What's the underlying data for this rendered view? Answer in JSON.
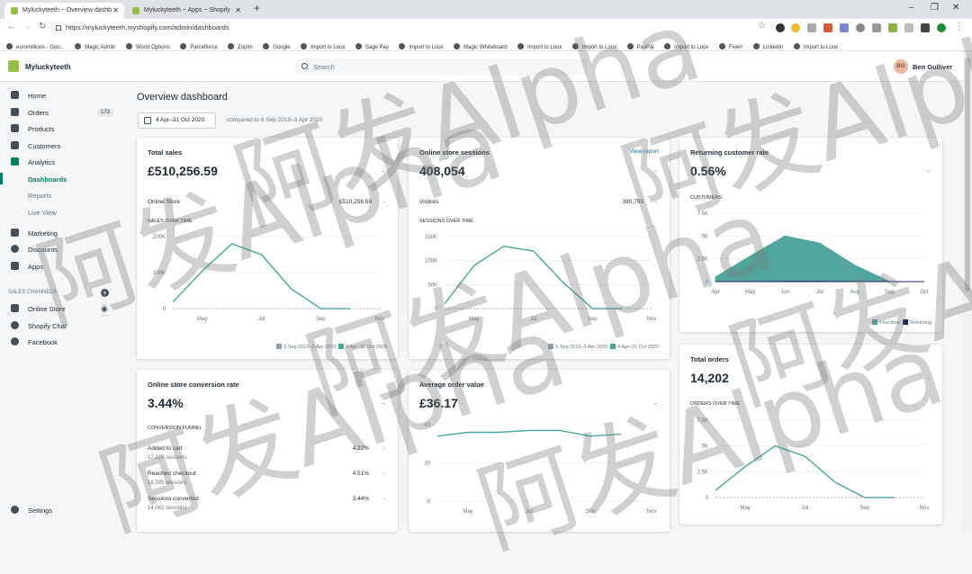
{
  "browser": {
    "tabs": [
      {
        "title": "Myluckyteeth ~ Overview dashb"
      },
      {
        "title": "Myluckyteeth ~ Apps ~ Shopify"
      }
    ],
    "url": "https://myluckyteeth.myshopify.com/admin/dashboards",
    "bookmarks": [
      "euromillions - Goo...",
      "Magic Admin",
      "World Options",
      "Parcelforce",
      "Zopim",
      "Google",
      "Import to Loox",
      "Sage Pay",
      "Import to Loox",
      "Magic Whiteboard",
      "Import to Loox",
      "Import to Loox",
      "PayPal",
      "Import to Loox",
      "Fiverr",
      "LinkedIn",
      "Import to Loox"
    ]
  },
  "topnav": {
    "store": "Myluckyteeth",
    "search_placeholder": "Search",
    "avatar": "BG",
    "user": "Ben Gulliver"
  },
  "sidebar": {
    "items": [
      {
        "label": "Home",
        "icon": "home-icon"
      },
      {
        "label": "Orders",
        "icon": "orders-icon",
        "badge": "173"
      },
      {
        "label": "Products",
        "icon": "tag-icon"
      },
      {
        "label": "Customers",
        "icon": "person-icon"
      },
      {
        "label": "Analytics",
        "icon": "bar-chart-icon"
      },
      {
        "label": "Dashboards"
      },
      {
        "label": "Reports"
      },
      {
        "label": "Live View"
      },
      {
        "label": "Marketing",
        "icon": "megaphone-icon"
      },
      {
        "label": "Discounts",
        "icon": "discount-icon"
      },
      {
        "label": "Apps",
        "icon": "apps-icon"
      }
    ],
    "channels_header": "SALES CHANNELS",
    "channels": [
      {
        "label": "Online Store",
        "icon": "store-icon"
      },
      {
        "label": "Shopify Chat",
        "icon": "chat-icon"
      },
      {
        "label": "Facebook",
        "icon": "facebook-icon"
      }
    ],
    "settings": "Settings"
  },
  "main": {
    "title": "Overview dashboard",
    "date_range": "4 Apr–31 Oct 2020",
    "compared": "compared to 6 Sep 2019–3 Apr 2020"
  },
  "cards": {
    "total_sales": {
      "title": "Total sales",
      "value": "£510,256.59",
      "dash": "-",
      "row_label": "Online Store",
      "row_value": "£510,256.59",
      "row_dash": "-",
      "caption": "SALES OVER TIME",
      "legend_prev": "6 Sep 2019–3 Apr 2020",
      "legend_cur": "4 Apr–31 Oct 2020"
    },
    "sessions": {
      "title": "Online store sessions",
      "link": "View report",
      "value": "408,054",
      "dash": "-",
      "row_label": "Visitors",
      "row_value": "390,755",
      "row_dash": "-",
      "caption": "SESSIONS OVER TIME",
      "legend_prev": "6 Sep 2019–3 Apr 2020",
      "legend_cur": "4 Apr–31 Oct 2020"
    },
    "returning": {
      "title": "Returning customer rate",
      "value": "0.56%",
      "dash": "-",
      "caption": "CUSTOMERS",
      "legend_first": "First-time",
      "legend_returning": "Returning"
    },
    "conversion": {
      "title": "Online store conversion rate",
      "value": "3.44%",
      "dash": "-",
      "caption": "CONVERSION FUNNEL",
      "rows": [
        {
          "label": "Added to cart",
          "sessions": "17,220 sessions",
          "pct": "4.22%",
          "dash": "-"
        },
        {
          "label": "Reached checkout",
          "sessions": "18,395 sessions",
          "pct": "4.51%",
          "dash": "-"
        },
        {
          "label": "Sessions converted",
          "sessions": "14,042 sessions",
          "pct": "3.44%",
          "dash": "-"
        }
      ]
    },
    "aov": {
      "title": "Average order value",
      "value": "£36.17",
      "dash": "-"
    },
    "orders": {
      "title": "Total orders",
      "value": "14,202",
      "dash": "-",
      "caption": "ORDERS OVER TIME"
    }
  },
  "chart_data": [
    {
      "type": "line",
      "id": "sales",
      "x": [
        "Apr",
        "May",
        "Jun",
        "Jul",
        "Aug",
        "Sep",
        "Oct",
        "Nov"
      ],
      "y_ticks": [
        "0",
        "100K",
        "200K"
      ],
      "ylim": [
        0,
        200000
      ],
      "x_ticks": [
        "May",
        "Jul",
        "Sep",
        "Nov"
      ],
      "series": [
        {
          "name": "4 Apr–31 Oct 2020",
          "color": "#47a69c",
          "values": [
            18000,
            105000,
            180000,
            150000,
            55000,
            0,
            0,
            null
          ]
        },
        {
          "name": "6 Sep 2019–3 Apr 2020",
          "color": "#919eab",
          "dashed": true,
          "values": [
            0,
            0,
            0,
            0,
            0,
            0,
            0,
            0
          ]
        }
      ]
    },
    {
      "type": "line",
      "id": "sessions",
      "x": [
        "Apr",
        "May",
        "Jun",
        "Jul",
        "Aug",
        "Sep",
        "Oct",
        "Nov"
      ],
      "y_ticks": [
        "0",
        "50K",
        "100K",
        "150K"
      ],
      "ylim": [
        0,
        150000
      ],
      "x_ticks": [
        "May",
        "Jul",
        "Sep",
        "Nov"
      ],
      "series": [
        {
          "name": "4 Apr–31 Oct 2020",
          "color": "#47a69c",
          "values": [
            10000,
            90000,
            130000,
            120000,
            55000,
            0,
            0,
            null
          ]
        },
        {
          "name": "6 Sep 2019–3 Apr 2020",
          "color": "#919eab",
          "dashed": true,
          "values": [
            0,
            0,
            0,
            0,
            0,
            0,
            0,
            0
          ]
        }
      ]
    },
    {
      "type": "area",
      "id": "customers",
      "x": [
        "Apr",
        "May",
        "Jun",
        "Jul",
        "Aug",
        "Sep",
        "Oct"
      ],
      "y_ticks": [
        "0",
        "2.5K",
        "5K",
        "7.5K"
      ],
      "ylim": [
        0,
        7500
      ],
      "x_ticks": [
        "Apr",
        "May",
        "Jun",
        "Jul",
        "Aug",
        "Sep",
        "Oct"
      ],
      "series": [
        {
          "name": "First-time",
          "color": "#50a69c",
          "values": [
            500,
            2800,
            5000,
            4200,
            1800,
            0,
            0
          ]
        },
        {
          "name": "Returning",
          "color": "#1c2260",
          "values": [
            0,
            0,
            30,
            30,
            0,
            0,
            0
          ]
        }
      ]
    },
    {
      "type": "line",
      "id": "aov",
      "x": [
        "Apr",
        "May",
        "Jun",
        "Jul",
        "Aug",
        "Sep",
        "Oct",
        "Nov"
      ],
      "y_ticks": [
        "0",
        "20",
        "40"
      ],
      "ylim": [
        0,
        40
      ],
      "x_ticks": [
        "May",
        "Jul",
        "Sep",
        "Nov"
      ],
      "series": [
        {
          "name": "4 Apr–31 Oct 2020",
          "color": "#47a69c",
          "values": [
            34,
            36,
            36,
            37,
            37,
            34,
            35,
            null
          ]
        }
      ]
    },
    {
      "type": "line",
      "id": "orders",
      "x": [
        "Apr",
        "May",
        "Jun",
        "Jul",
        "Aug",
        "Sep",
        "Oct",
        "Nov"
      ],
      "y_ticks": [
        "0",
        "2.5K",
        "5K",
        "7.5K"
      ],
      "ylim": [
        0,
        7500
      ],
      "x_ticks": [
        "May",
        "Jul",
        "Sep",
        "Nov"
      ],
      "series": [
        {
          "name": "4 Apr–31 Oct 2020",
          "color": "#47a69c",
          "values": [
            700,
            3000,
            5000,
            4000,
            1500,
            0,
            0,
            null
          ]
        },
        {
          "name": "6 Sep 2019–3 Apr 2020",
          "color": "#919eab",
          "dashed": true,
          "values": [
            0,
            0,
            0,
            0,
            0,
            0,
            0,
            0
          ]
        }
      ]
    }
  ],
  "watermark": "阿发Alpha"
}
